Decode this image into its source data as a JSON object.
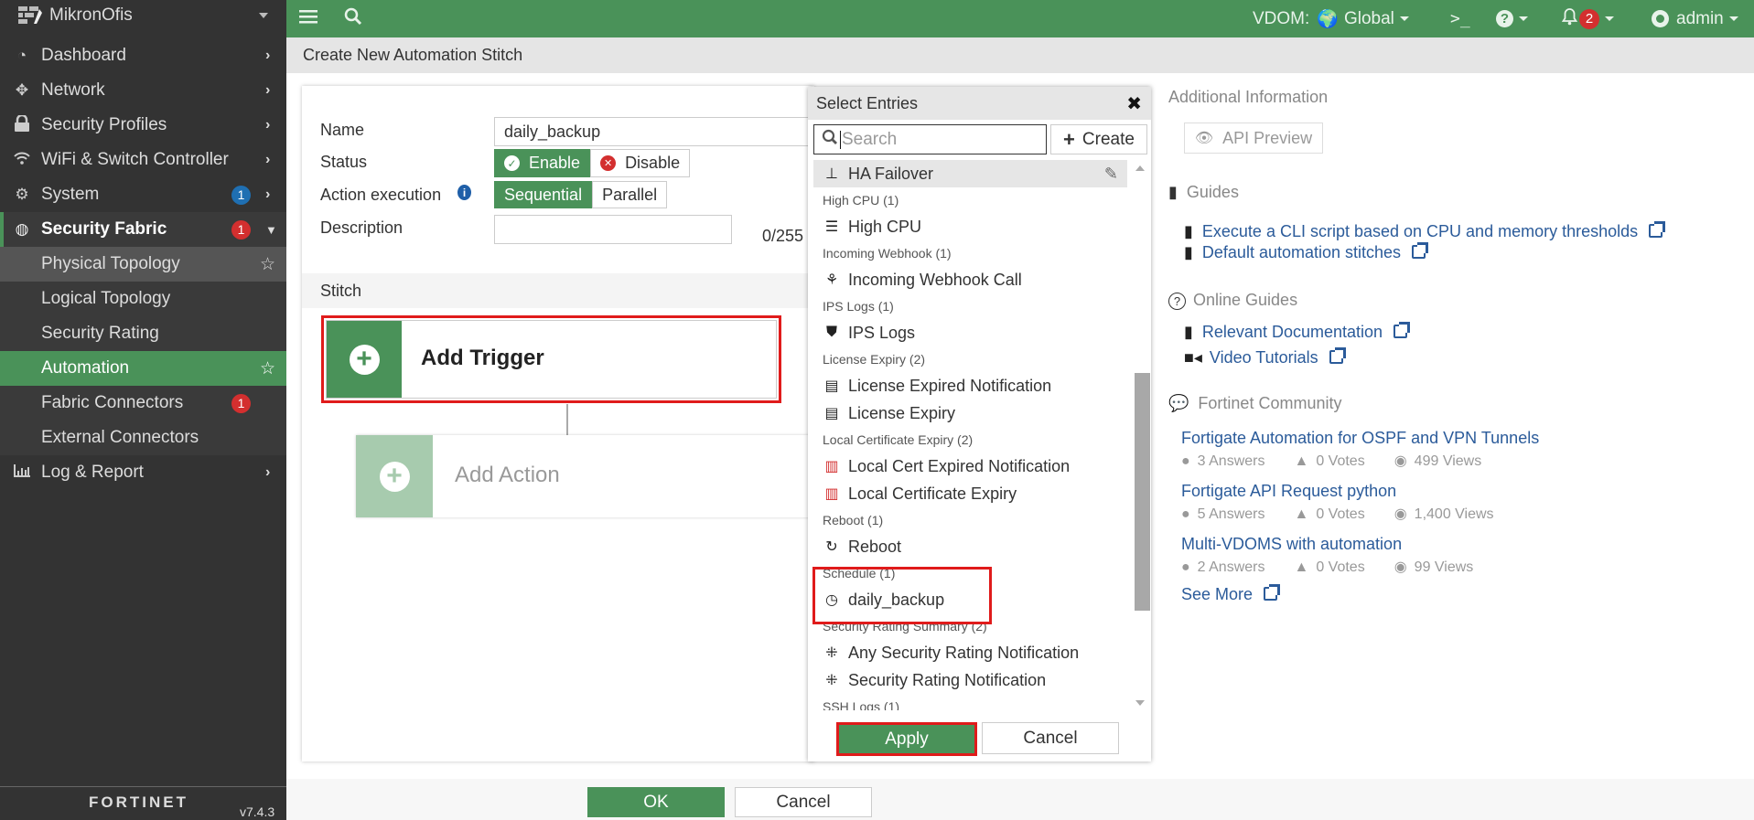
{
  "sidebar": {
    "device_name": "MikronOfis",
    "items": [
      {
        "label": "Dashboard",
        "icon": "dashboard-icon"
      },
      {
        "label": "Network",
        "icon": "network-icon"
      },
      {
        "label": "Security Profiles",
        "icon": "lock-icon"
      },
      {
        "label": "WiFi & Switch Controller",
        "icon": "wifi-icon"
      },
      {
        "label": "System",
        "icon": "gear-icon",
        "badge": "1"
      },
      {
        "label": "Security Fabric",
        "icon": "fabric-icon",
        "badge": "1"
      },
      {
        "label": "Log & Report",
        "icon": "chart-icon"
      }
    ],
    "subitems": [
      {
        "label": "Physical Topology"
      },
      {
        "label": "Logical Topology"
      },
      {
        "label": "Security Rating"
      },
      {
        "label": "Automation"
      },
      {
        "label": "Fabric Connectors",
        "badge": "1"
      },
      {
        "label": "External Connectors"
      }
    ],
    "brand": "FORTINET",
    "version": "v7.4.3"
  },
  "topbar": {
    "vdom_label": "VDOM:",
    "vdom_value": "Global",
    "notifications_count": "2",
    "user": "admin"
  },
  "page": {
    "title": "Create New Automation Stitch"
  },
  "form": {
    "name_label": "Name",
    "name_value": "daily_backup",
    "status_label": "Status",
    "status_enable": "Enable",
    "status_disable": "Disable",
    "exec_label": "Action execution",
    "exec_sequential": "Sequential",
    "exec_parallel": "Parallel",
    "desc_label": "Description",
    "desc_value": "",
    "desc_count": "0/255",
    "stitch_label": "Stitch",
    "add_trigger": "Add Trigger",
    "add_action": "Add Action"
  },
  "dialog": {
    "title": "Select Entries",
    "search_placeholder": "Search",
    "create_label": "Create",
    "entries": [
      {
        "type": "entry",
        "label": "HA Failover",
        "icon": "ha-icon",
        "selected": true
      },
      {
        "type": "group",
        "label": "High CPU (1)"
      },
      {
        "type": "entry",
        "label": "High CPU",
        "icon": "server-icon"
      },
      {
        "type": "group",
        "label": "Incoming Webhook (1)"
      },
      {
        "type": "entry",
        "label": "Incoming Webhook Call",
        "icon": "webhook-icon"
      },
      {
        "type": "group",
        "label": "IPS Logs (1)"
      },
      {
        "type": "entry",
        "label": "IPS Logs",
        "icon": "shield-icon"
      },
      {
        "type": "group",
        "label": "License Expiry (2)"
      },
      {
        "type": "entry",
        "label": "License Expired Notification",
        "icon": "license-icon"
      },
      {
        "type": "entry",
        "label": "License Expiry",
        "icon": "license-icon"
      },
      {
        "type": "group",
        "label": "Local Certificate Expiry (2)"
      },
      {
        "type": "entry",
        "label": "Local Cert Expired Notification",
        "icon": "certificate-icon"
      },
      {
        "type": "entry",
        "label": "Local Certificate Expiry",
        "icon": "certificate-icon"
      },
      {
        "type": "group",
        "label": "Reboot (1)"
      },
      {
        "type": "entry",
        "label": "Reboot",
        "icon": "reboot-icon"
      },
      {
        "type": "group",
        "label": "Schedule (1)"
      },
      {
        "type": "entry",
        "label": "daily_backup",
        "icon": "clock-icon"
      },
      {
        "type": "group",
        "label": "Security Rating Summary (2)"
      },
      {
        "type": "entry",
        "label": "Any Security Rating Notification",
        "icon": "rating-icon"
      },
      {
        "type": "entry",
        "label": "Security Rating Notification",
        "icon": "rating-icon"
      },
      {
        "type": "group",
        "label": "SSH Logs (1)"
      }
    ],
    "apply_label": "Apply",
    "cancel_label": "Cancel"
  },
  "info": {
    "title": "Additional Information",
    "api_preview": "API Preview",
    "guides_title": "Guides",
    "guides": [
      "Execute a CLI script based on CPU and memory thresholds",
      "Default automation stitches"
    ],
    "online_title": "Online Guides",
    "online": [
      {
        "label": "Relevant Documentation",
        "icon": "book-icon"
      },
      {
        "label": "Video Tutorials",
        "icon": "video-icon"
      }
    ],
    "community_title": "Fortinet Community",
    "posts": [
      {
        "title": "Fortigate Automation for OSPF and VPN Tunnels",
        "answers": "3 Answers",
        "votes": "0 Votes",
        "views": "499 Views"
      },
      {
        "title": "Fortigate API Request python",
        "answers": "5 Answers",
        "votes": "0 Votes",
        "views": "1,400 Views"
      },
      {
        "title": "Multi-VDOMS with automation",
        "answers": "2 Answers",
        "votes": "0 Votes",
        "views": "99 Views"
      }
    ],
    "see_more": "See More"
  },
  "footer": {
    "ok_label": "OK",
    "cancel_label": "Cancel"
  }
}
